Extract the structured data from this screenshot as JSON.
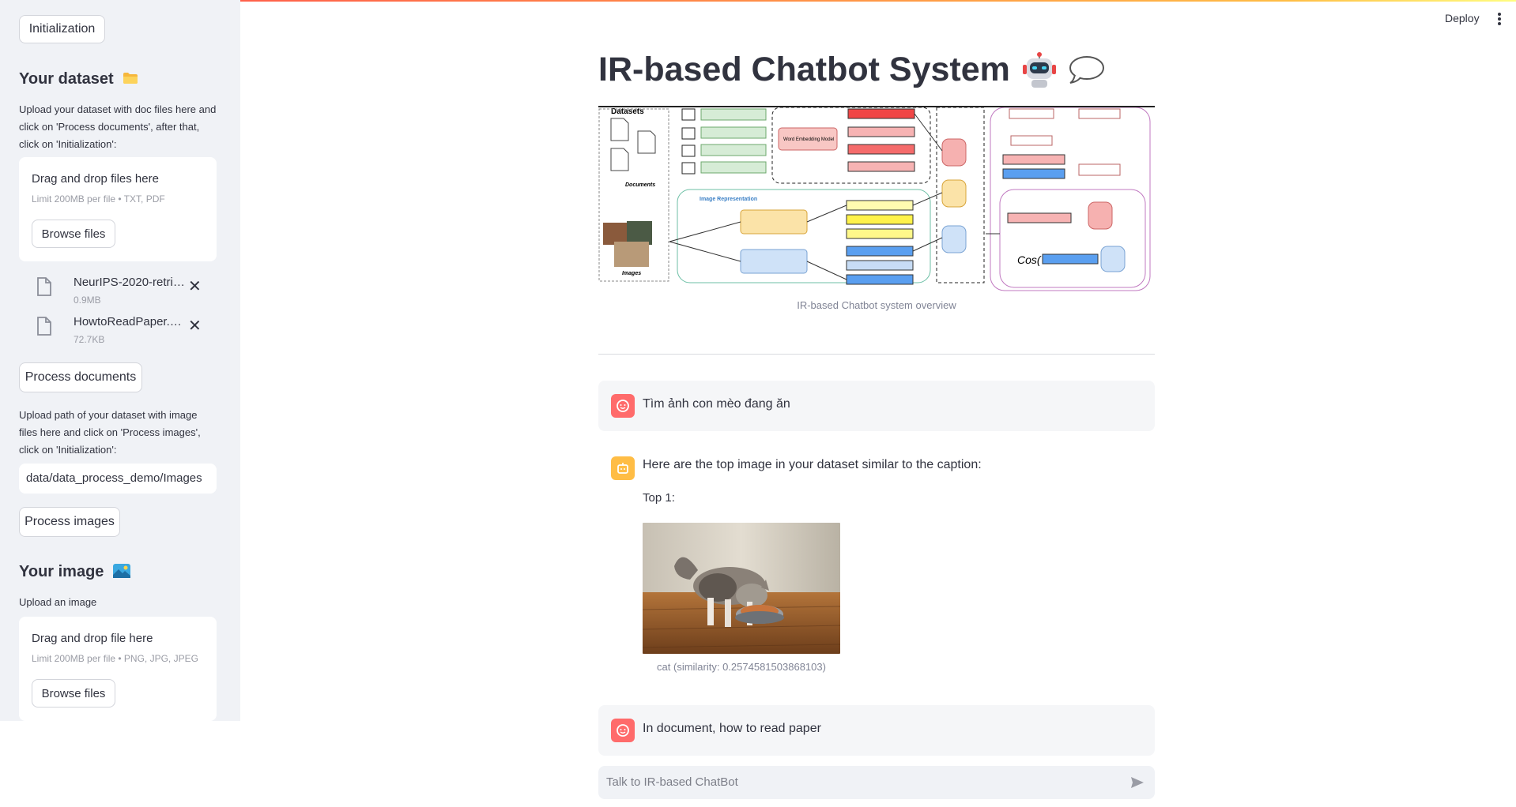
{
  "sidebar": {
    "init_top_label": "Initialization",
    "dataset_heading": "Your dataset",
    "dataset_heading_emoji": "folder-icon",
    "dataset_help": "Upload your dataset with doc files here and click on 'Process documents', after that, click on 'Initialization':",
    "doc_dropzone": {
      "title": "Drag and drop files here",
      "limit": "Limit 200MB per file • TXT, PDF",
      "browse_label": "Browse files"
    },
    "files": [
      {
        "name": "NeurIPS-2020-retri…",
        "size": "0.9MB"
      },
      {
        "name": "HowtoReadPaper.pdf",
        "size": "72.7KB"
      }
    ],
    "process_docs_label": "Process documents",
    "image_path_help": "Upload path of your dataset with image files here and click on 'Process images', click on 'Initialization':",
    "image_path_value": "data/data_process_demo/Images",
    "process_images_label": "Process images",
    "image_heading": "Your image",
    "image_heading_emoji": "picture-icon",
    "image_upload_label": "Upload an image",
    "img_dropzone": {
      "title": "Drag and drop file here",
      "limit": "Limit 200MB per file • PNG, JPG, JPEG",
      "browse_label": "Browse files"
    }
  },
  "header": {
    "deploy_label": "Deploy"
  },
  "main": {
    "title": "IR-based Chatbot System",
    "diagram_caption": "IR-based Chatbot system overview",
    "messages": [
      {
        "role": "user",
        "text": "Tìm ảnh con mèo đang ăn"
      },
      {
        "role": "assistant",
        "text": "Here are the top image in your dataset similar to the caption:",
        "top_label": "Top 1:",
        "image_caption": "cat (similarity: 0.2574581503868103)"
      },
      {
        "role": "user",
        "text": "In document, how to read paper"
      }
    ],
    "chat_placeholder": "Talk to IR-based ChatBot"
  },
  "colors": {
    "accent": "#ff4b4b",
    "sidebar_bg": "#f0f2f6",
    "user_avatar": "#ff6b6b",
    "bot_avatar": "#ffbd45"
  }
}
